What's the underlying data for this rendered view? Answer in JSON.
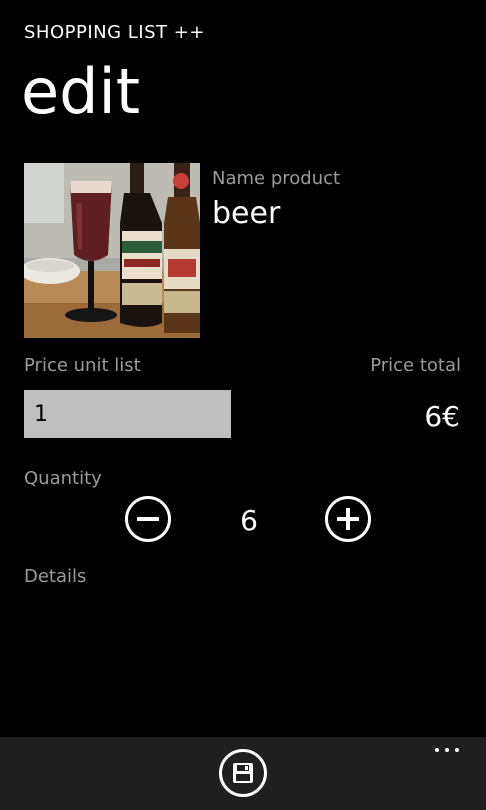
{
  "header": {
    "app_title": "SHOPPING LIST ++",
    "page_title": "edit"
  },
  "product": {
    "image": "beer-photo",
    "name_label": "Name product",
    "name_value": "beer"
  },
  "price": {
    "unit_label": "Price unit list",
    "unit_value": "1",
    "total_label": "Price total",
    "total_value": "6€"
  },
  "quantity": {
    "label": "Quantity",
    "value": "6",
    "minus_icon": "minus-circle-icon",
    "plus_icon": "plus-circle-icon"
  },
  "details": {
    "label": "Details"
  },
  "app_bar": {
    "save_icon": "save-disk-icon",
    "more_icon": "ellipsis-icon"
  },
  "colors": {
    "background": "#000000",
    "secondary_text": "#9a9a9a",
    "input_background": "#bfbfbf",
    "app_bar": "#1f1f1f"
  }
}
